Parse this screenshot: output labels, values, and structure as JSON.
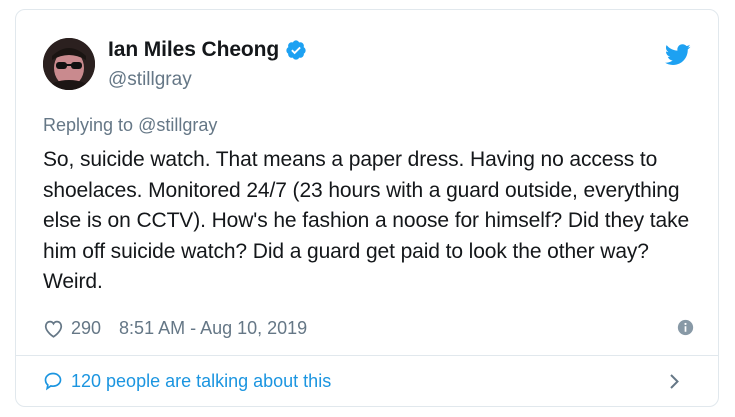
{
  "tweet": {
    "author": {
      "name": "Ian Miles Cheong",
      "handle": "@stillgray",
      "verified": true
    },
    "replying_prefix": "Replying to",
    "replying_to": "@stillgray",
    "text": "So, suicide watch. That means a paper dress. Having no access to shoelaces. Monitored 24/7 (23 hours with a guard outside, everything else is on CCTV). How's he fashion a noose for himself? Did they take him off suicide watch? Did a guard get paid to look the other way? Weird.",
    "likes": "290",
    "timestamp": "8:51 AM - Aug 10, 2019",
    "talking": "120 people are talking about this"
  },
  "icons": {
    "verified": "verified-badge-icon",
    "platform": "twitter-bird-icon",
    "like": "heart-icon",
    "info": "info-icon",
    "conversation": "speech-bubble-icon",
    "expand": "chevron-right-icon"
  },
  "colors": {
    "brand_blue": "#1da1f2",
    "link_blue": "#1b95e0",
    "text": "#14171a",
    "muted": "#657786",
    "border": "#e1e8ed"
  }
}
